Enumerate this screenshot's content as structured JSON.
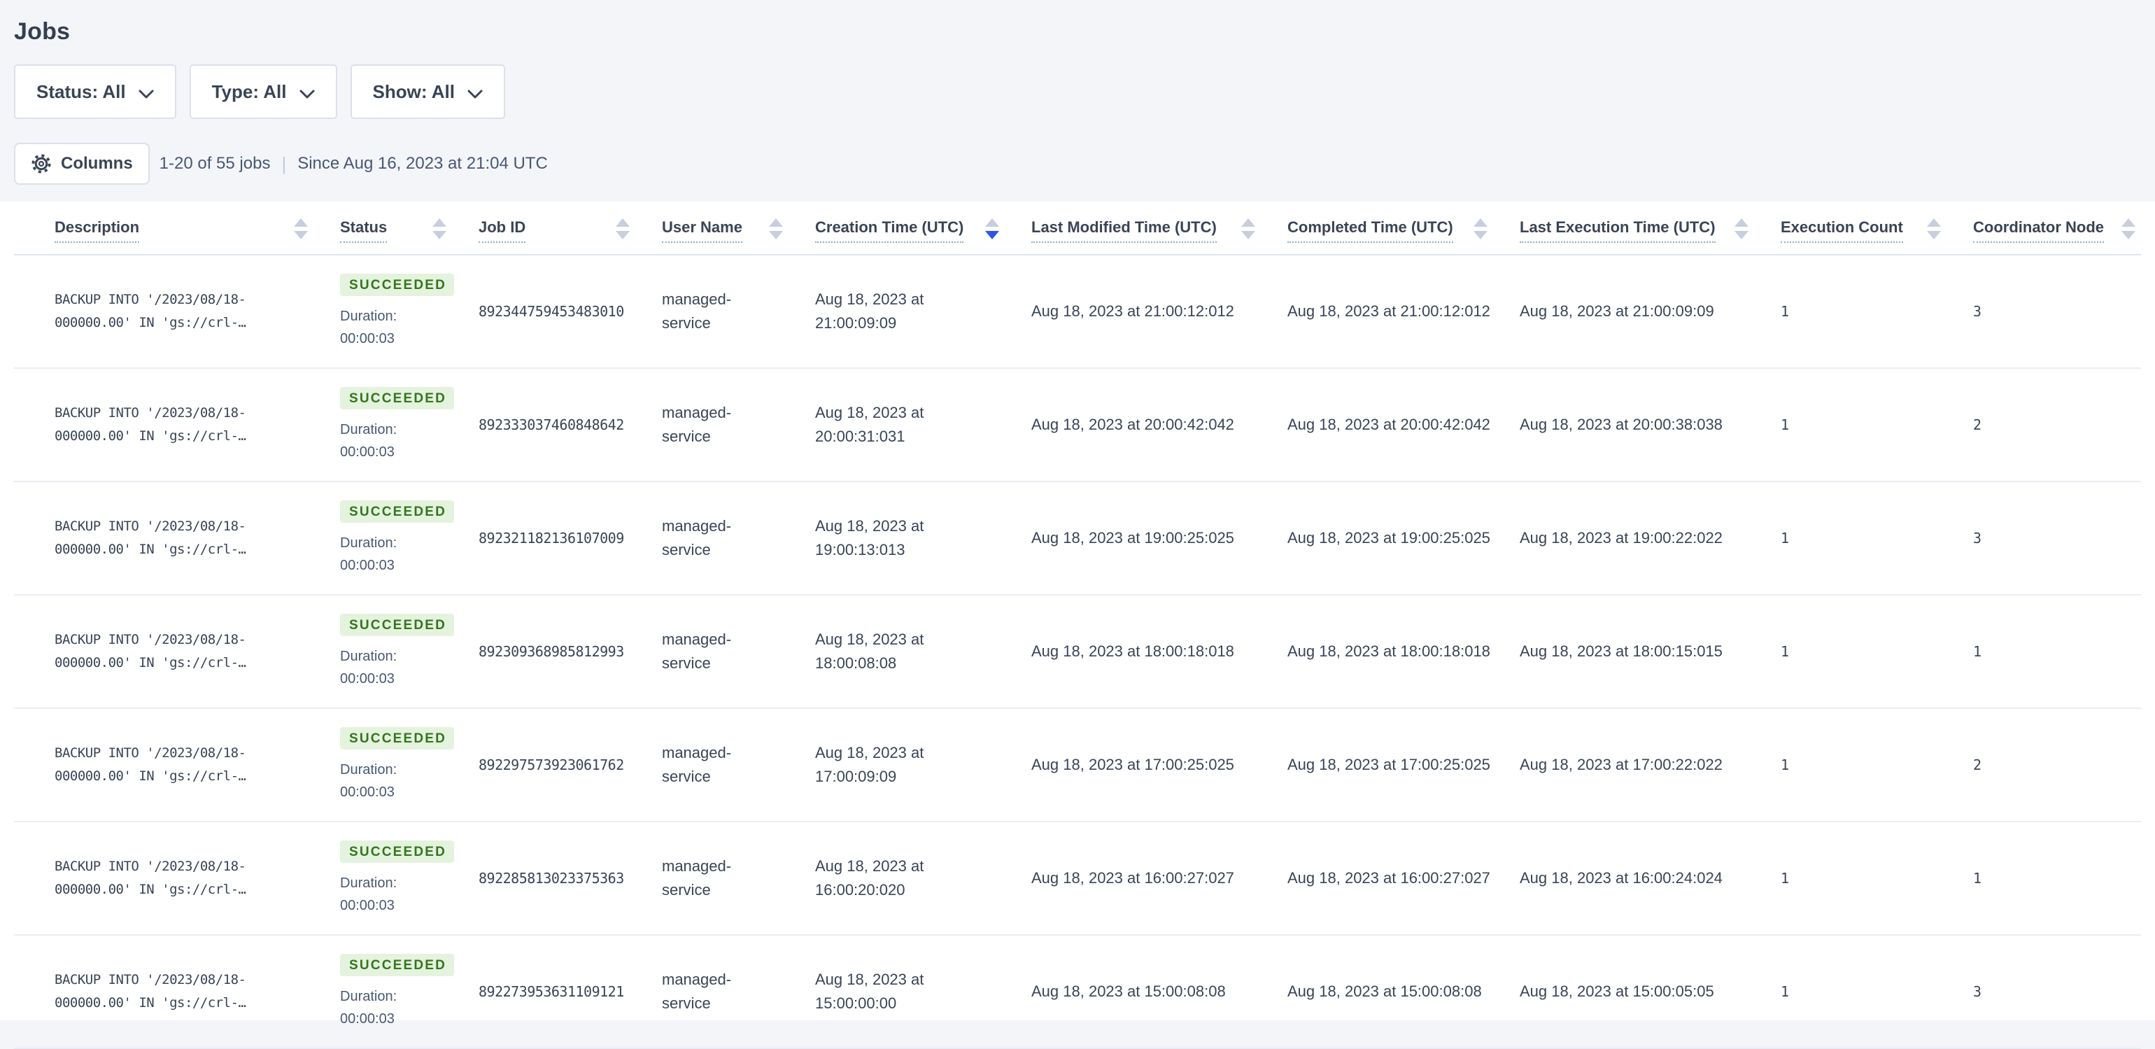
{
  "page": {
    "title": "Jobs"
  },
  "filters": [
    {
      "label": "Status: All"
    },
    {
      "label": "Type: All"
    },
    {
      "label": "Show: All"
    }
  ],
  "toolbar": {
    "columns_label": "Columns",
    "count_text": "1-20 of 55 jobs",
    "divider": "|",
    "since_text": "Since Aug 16, 2023 at 21:04 UTC"
  },
  "icons": {
    "columns_button": "gear-icon",
    "filter_buttons": "chevron-down-icon",
    "column_headers": "sort-arrows-icon"
  },
  "colors": {
    "page_background": "#f4f5f9",
    "panel_background": "#ffffff",
    "text_primary": "#394455",
    "text_secondary": "#475872",
    "border_light": "#dbe0ea",
    "row_separator": "#e9edf4",
    "badge_success_bg": "#e4f3dd",
    "badge_success_text": "#33751f",
    "sort_active": "#2b55ea",
    "sort_inactive": "#c7cede"
  },
  "table": {
    "columns": [
      {
        "label": "Description",
        "sort": "none"
      },
      {
        "label": "Status",
        "sort": "none"
      },
      {
        "label": "Job ID",
        "sort": "none"
      },
      {
        "label": "User Name",
        "sort": "none"
      },
      {
        "label": "Creation Time (UTC)",
        "sort": "desc"
      },
      {
        "label": "Last Modified Time (UTC)",
        "sort": "none"
      },
      {
        "label": "Completed Time (UTC)",
        "sort": "none"
      },
      {
        "label": "Last Execution Time (UTC)",
        "sort": "none"
      },
      {
        "label": "Execution Count",
        "sort": "none"
      },
      {
        "label": "Coordinator Node",
        "sort": "none"
      }
    ],
    "rows": [
      {
        "description_line1": "BACKUP INTO '/2023/08/18-",
        "description_line2": "000000.00' IN 'gs://crl-…",
        "status": "SUCCEEDED",
        "duration_label": "Duration:",
        "duration_value": "00:00:03",
        "job_id": "892344759453483010",
        "user_line1": "managed-",
        "user_line2": "service",
        "creation_line1": "Aug 18, 2023 at",
        "creation_line2": "21:00:09:09",
        "last_modified": "Aug 18, 2023 at 21:00:12:012",
        "completed": "Aug 18, 2023 at 21:00:12:012",
        "last_execution": "Aug 18, 2023 at 21:00:09:09",
        "execution_count": "1",
        "coordinator_node": "3"
      },
      {
        "description_line1": "BACKUP INTO '/2023/08/18-",
        "description_line2": "000000.00' IN 'gs://crl-…",
        "status": "SUCCEEDED",
        "duration_label": "Duration:",
        "duration_value": "00:00:03",
        "job_id": "892333037460848642",
        "user_line1": "managed-",
        "user_line2": "service",
        "creation_line1": "Aug 18, 2023 at",
        "creation_line2": "20:00:31:031",
        "last_modified": "Aug 18, 2023 at 20:00:42:042",
        "completed": "Aug 18, 2023 at 20:00:42:042",
        "last_execution": "Aug 18, 2023 at 20:00:38:038",
        "execution_count": "1",
        "coordinator_node": "2"
      },
      {
        "description_line1": "BACKUP INTO '/2023/08/18-",
        "description_line2": "000000.00' IN 'gs://crl-…",
        "status": "SUCCEEDED",
        "duration_label": "Duration:",
        "duration_value": "00:00:03",
        "job_id": "892321182136107009",
        "user_line1": "managed-",
        "user_line2": "service",
        "creation_line1": "Aug 18, 2023 at",
        "creation_line2": "19:00:13:013",
        "last_modified": "Aug 18, 2023 at 19:00:25:025",
        "completed": "Aug 18, 2023 at 19:00:25:025",
        "last_execution": "Aug 18, 2023 at 19:00:22:022",
        "execution_count": "1",
        "coordinator_node": "3"
      },
      {
        "description_line1": "BACKUP INTO '/2023/08/18-",
        "description_line2": "000000.00' IN 'gs://crl-…",
        "status": "SUCCEEDED",
        "duration_label": "Duration:",
        "duration_value": "00:00:03",
        "job_id": "892309368985812993",
        "user_line1": "managed-",
        "user_line2": "service",
        "creation_line1": "Aug 18, 2023 at",
        "creation_line2": "18:00:08:08",
        "last_modified": "Aug 18, 2023 at 18:00:18:018",
        "completed": "Aug 18, 2023 at 18:00:18:018",
        "last_execution": "Aug 18, 2023 at 18:00:15:015",
        "execution_count": "1",
        "coordinator_node": "1"
      },
      {
        "description_line1": "BACKUP INTO '/2023/08/18-",
        "description_line2": "000000.00' IN 'gs://crl-…",
        "status": "SUCCEEDED",
        "duration_label": "Duration:",
        "duration_value": "00:00:03",
        "job_id": "892297573923061762",
        "user_line1": "managed-",
        "user_line2": "service",
        "creation_line1": "Aug 18, 2023 at",
        "creation_line2": "17:00:09:09",
        "last_modified": "Aug 18, 2023 at 17:00:25:025",
        "completed": "Aug 18, 2023 at 17:00:25:025",
        "last_execution": "Aug 18, 2023 at 17:00:22:022",
        "execution_count": "1",
        "coordinator_node": "2"
      },
      {
        "description_line1": "BACKUP INTO '/2023/08/18-",
        "description_line2": "000000.00' IN 'gs://crl-…",
        "status": "SUCCEEDED",
        "duration_label": "Duration:",
        "duration_value": "00:00:03",
        "job_id": "892285813023375363",
        "user_line1": "managed-",
        "user_line2": "service",
        "creation_line1": "Aug 18, 2023 at",
        "creation_line2": "16:00:20:020",
        "last_modified": "Aug 18, 2023 at 16:00:27:027",
        "completed": "Aug 18, 2023 at 16:00:27:027",
        "last_execution": "Aug 18, 2023 at 16:00:24:024",
        "execution_count": "1",
        "coordinator_node": "1"
      },
      {
        "description_line1": "BACKUP INTO '/2023/08/18-",
        "description_line2": "000000.00' IN 'gs://crl-…",
        "status": "SUCCEEDED",
        "duration_label": "Duration:",
        "duration_value": "00:00:03",
        "job_id": "892273953631109121",
        "user_line1": "managed-",
        "user_line2": "service",
        "creation_line1": "Aug 18, 2023 at",
        "creation_line2": "15:00:00:00",
        "last_modified": "Aug 18, 2023 at 15:00:08:08",
        "completed": "Aug 18, 2023 at 15:00:08:08",
        "last_execution": "Aug 18, 2023 at 15:00:05:05",
        "execution_count": "1",
        "coordinator_node": "3"
      }
    ]
  }
}
